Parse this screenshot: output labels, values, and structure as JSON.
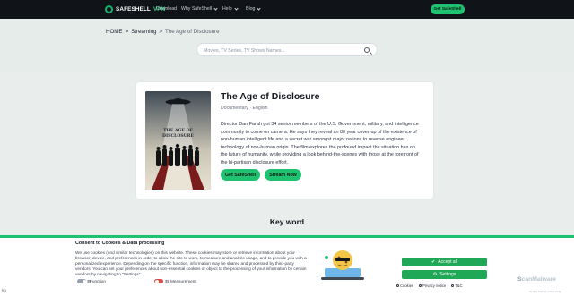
{
  "nav": {
    "brand": "SAFESHELL",
    "brand_vpn": "VPN",
    "links": [
      "Download",
      "Why SafeShell",
      "Help",
      "Blog"
    ],
    "cta": "Get SafeShell"
  },
  "breadcrumb": {
    "home": "HOME",
    "sep": ">",
    "streaming": "Streaming",
    "current": "The Age of Disclosure"
  },
  "search": {
    "placeholder": "Movies, TV Series, TV Shows Names..."
  },
  "movie": {
    "title": "The Age of Disclosure",
    "genre": "Documentary",
    "dot": "·",
    "language": "English",
    "description": "Director Dan Farah got 34 senior members of the U.S. Government, military, and intelligence community to come on camera. He says they reveal an 80 year cover-up of the existence of non-human intelligent life and a secret war amongst major nations to reverse engineer technology of non-human origin. The film explores the profound impact the situation has on the future of humanity, while providing a look behind-the-scenes with those at the forefront of the bi-partisan disclosure effort.",
    "buttons": {
      "primary": "Get SafeShell",
      "secondary": "Stream Now"
    },
    "poster_text": "THE AGE OF DISCLOSURE"
  },
  "section": {
    "keyword_title": "Key word"
  },
  "cookie": {
    "title": "Consent to Cookies & Data processing",
    "text": "We use cookies (and similar technologies) on this website. These cookies may store or retrieve information about your browser, device, and preferences in order to allow the site to work, to measure and analyze usage, and to provide you with a personalized experience. Depending on the specific function, information may be shared and processed by third-party vendors. You can set your preferences about non-essential cookies or object to the processing of your information by certain vendors by navigating to \"Settings\".",
    "toggle_function": "Function",
    "toggle_measurement": "Measurement",
    "accept_label": "Accept all",
    "settings_label": "Settings",
    "link_cookies": "Cookies",
    "link_privacy": "Privacy notice",
    "link_tc": "T&C",
    "watermark_s": "S",
    "watermark_rest": "canMalware",
    "watermark_sub": "Cookie banner powered by",
    "bottom_left": "kg"
  },
  "colors": {
    "accent_green": "#1fc270",
    "nav_bg": "#101418",
    "toggle_off_red": "#e24a4a"
  }
}
